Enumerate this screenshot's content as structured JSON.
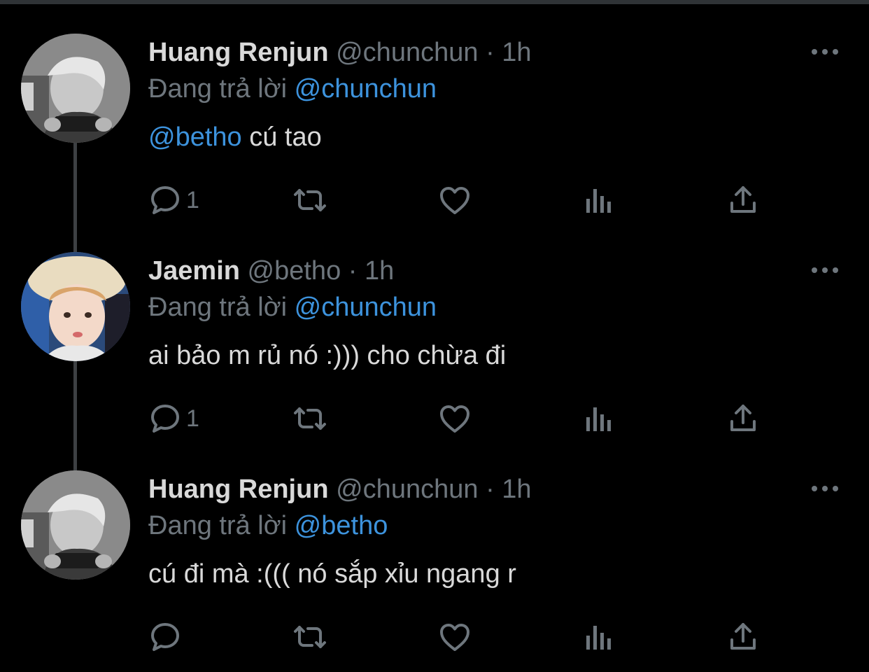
{
  "replying_label": "Đang trả lời",
  "tweets": [
    {
      "display_name": "Huang Renjun",
      "handle": "@chunchun",
      "separator": "·",
      "time": "1h",
      "reply_to": "@chunchun",
      "mention": "@betho",
      "text": " cú tao",
      "reply_count": "1"
    },
    {
      "display_name": "Jaemin",
      "handle": "@betho",
      "separator": "·",
      "time": "1h",
      "reply_to": "@chunchun",
      "mention": "",
      "text": "ai bảo m rủ nó :))) cho chừa đi",
      "reply_count": "1"
    },
    {
      "display_name": "Huang Renjun",
      "handle": "@chunchun",
      "separator": "·",
      "time": "1h",
      "reply_to": "@betho",
      "mention": "",
      "text": "cú đi mà :((( nó sắp xỉu ngang r",
      "reply_count": ""
    }
  ],
  "icons": {
    "reply": "reply-icon",
    "retweet": "retweet-icon",
    "like": "like-icon",
    "stats": "stats-icon",
    "share": "share-icon",
    "more": "more-icon"
  },
  "colors": {
    "background": "#000000",
    "text": "#d9d9d9",
    "muted": "#6e767d",
    "link": "#3d93dd",
    "thread_line": "#3d4043"
  }
}
